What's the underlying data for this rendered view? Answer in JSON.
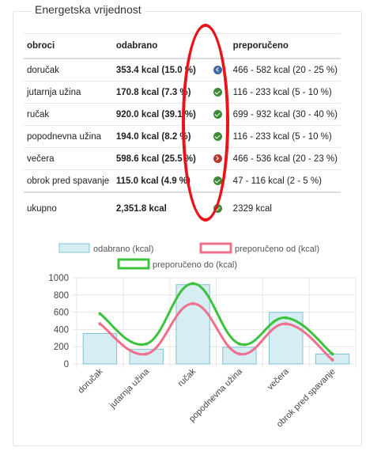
{
  "section_title": "Energetska vrijednost",
  "table": {
    "headers": [
      "obroci",
      "odabrano",
      "preporučeno"
    ],
    "rows": [
      {
        "meal": "doručak",
        "selected": "353.4 kcal (15.0 %)",
        "status": "low",
        "recommended": "466 - 582 kcal (20 - 25 %)"
      },
      {
        "meal": "jutarnja užina",
        "selected": "170.8 kcal (7.3 %)",
        "status": "ok",
        "recommended": "116 - 233 kcal (5 - 10 %)"
      },
      {
        "meal": "ručak",
        "selected": "920.0 kcal (39.1 %)",
        "status": "ok",
        "recommended": "699 - 932 kcal (30 - 40 %)"
      },
      {
        "meal": "popodnevna užina",
        "selected": "194.0 kcal (8.2 %)",
        "status": "ok",
        "recommended": "116 - 233 kcal (5 - 10 %)"
      },
      {
        "meal": "večera",
        "selected": "598.6 kcal (25.5 %)",
        "status": "high",
        "recommended": "466 - 536 kcal (20 - 23 %)"
      },
      {
        "meal": "obrok pred spavanje",
        "selected": "115.0 kcal (4.9 %)",
        "status": "ok",
        "recommended": "47 - 116 kcal (2 - 5 %)"
      }
    ],
    "total": {
      "label": "ukupno",
      "selected": "2,351.8 kcal",
      "status": "ok",
      "recommended": "2329 kcal"
    }
  },
  "chart_data": {
    "type": "bar",
    "categories": [
      "doručak",
      "jutarnja užina",
      "ručak",
      "popodnevna užina",
      "večera",
      "obrok pred spavanje"
    ],
    "series": [
      {
        "name": "odabrano (kcal)",
        "type": "bar",
        "color": "#d6edf3",
        "border": "#7fc3d6",
        "values": [
          353.4,
          170.8,
          920.0,
          194.0,
          598.6,
          115.0
        ]
      },
      {
        "name": "preporučeno od (kcal)",
        "type": "line",
        "color": "#f06f8c",
        "values": [
          466,
          116,
          699,
          116,
          466,
          47
        ]
      },
      {
        "name": "preporučeno do (kcal)",
        "type": "line",
        "color": "#3cc23c",
        "values": [
          582,
          233,
          932,
          233,
          536,
          116
        ]
      }
    ],
    "yticks": [
      0,
      200,
      400,
      600,
      800,
      1000
    ],
    "ylim": [
      0,
      1000
    ],
    "legend": "top"
  },
  "colors": {
    "annotation": "#e8131b",
    "ok": "#3c8a35",
    "low": "#3b6ca8",
    "high": "#b03a2e"
  }
}
